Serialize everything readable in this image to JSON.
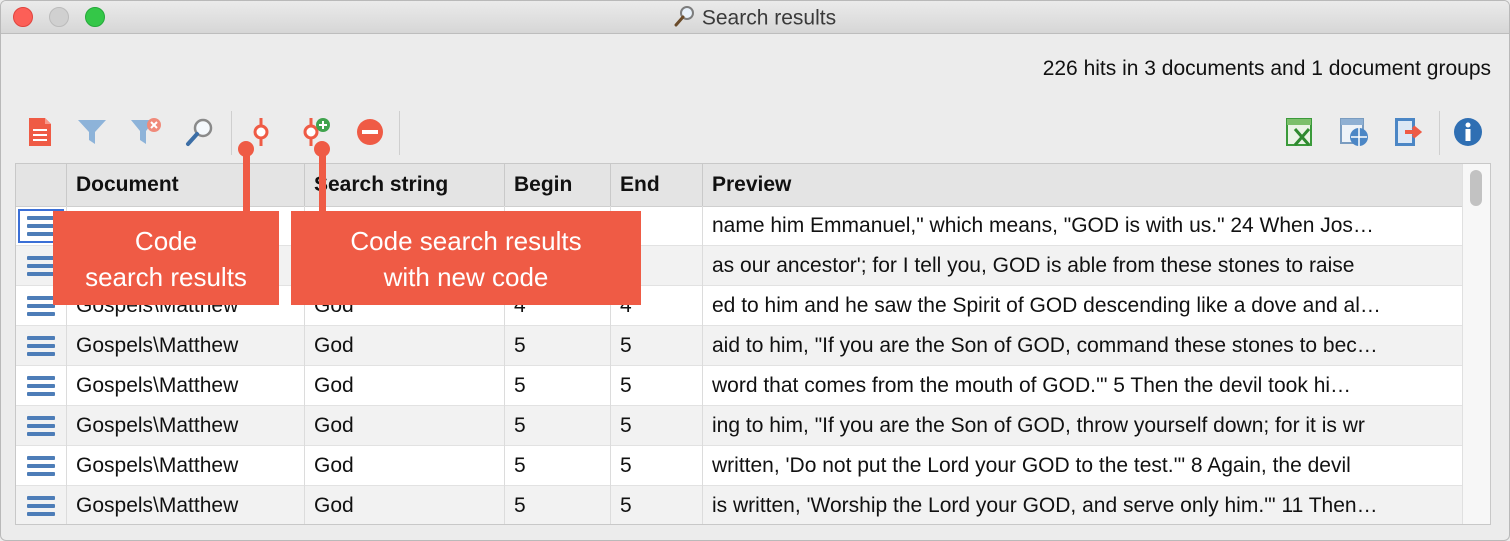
{
  "window": {
    "title": "Search results",
    "title_icon": "magnifier-icon"
  },
  "summary": {
    "hits_text": "226 hits in 3 documents and 1 document groups"
  },
  "toolbar": {
    "left_icons": [
      "document-list-icon",
      "filter-icon",
      "clear-filter-icon",
      "search-icon",
      "code-results-icon",
      "code-with-new-code-icon",
      "remove-icon"
    ],
    "right_icons": [
      "export-excel-icon",
      "export-html-icon",
      "export-icon",
      "info-icon"
    ]
  },
  "table": {
    "columns": [
      "",
      "Document",
      "Search string",
      "Begin",
      "End",
      "Preview"
    ],
    "rows": [
      {
        "document": "",
        "search": "",
        "begin": "",
        "end": "",
        "preview": " name him Emmanuel,\" which means, \"GOD is with us.\" 24 When Jos…"
      },
      {
        "document": "",
        "search": "",
        "begin": "",
        "end": "",
        "preview": " as our ancestor'; for I tell you, GOD is able from these stones to raise"
      },
      {
        "document": "Gospels\\Matthew",
        "search": "God",
        "begin": "4",
        "end": "4",
        "preview": "ed to him and he saw the Spirit of GOD descending like a dove and al…"
      },
      {
        "document": "Gospels\\Matthew",
        "search": "God",
        "begin": "5",
        "end": "5",
        "preview": "aid to him, \"If you are the Son of GOD, command these stones to bec…"
      },
      {
        "document": "Gospels\\Matthew",
        "search": "God",
        "begin": "5",
        "end": "5",
        "preview": " word that comes from the mouth of GOD.'\" 5 Then the devil took hi…"
      },
      {
        "document": "Gospels\\Matthew",
        "search": "God",
        "begin": "5",
        "end": "5",
        "preview": "ing to him, \"If you are the Son of GOD, throw yourself down; for it is wr"
      },
      {
        "document": "Gospels\\Matthew",
        "search": "God",
        "begin": "5",
        "end": "5",
        "preview": "written, 'Do not put the Lord your GOD to the test.'\" 8 Again, the devil"
      },
      {
        "document": "Gospels\\Matthew",
        "search": "God",
        "begin": "5",
        "end": "5",
        "preview": "is written, 'Worship the Lord your GOD, and serve only him.'\" 11 Then…"
      }
    ]
  },
  "callouts": {
    "code": {
      "line1": "Code",
      "line2": "search results"
    },
    "code_new": {
      "line1": "Code search results",
      "line2": "with new code"
    }
  },
  "colors": {
    "accent_red": "#ef5b45",
    "row_icon_blue": "#4d7db8",
    "excel_green": "#3a9a3a",
    "info_blue": "#2f6fb3"
  }
}
